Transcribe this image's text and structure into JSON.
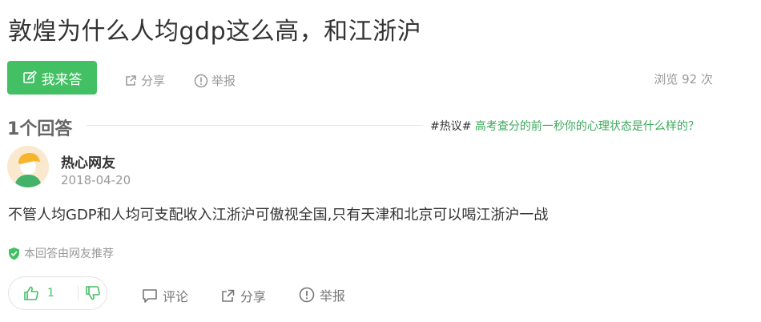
{
  "question": {
    "title": "敦煌为什么人均gdp这么高，和江浙沪",
    "answer_button_label": "我来答",
    "share_label": "分享",
    "report_label": "举报",
    "views_text": "浏览 92 次"
  },
  "answers_header": {
    "count_text": "1个回答",
    "topic_tag": "#热议#",
    "topic_question": "高考查分的前一秒你的心理状态是什么样的？"
  },
  "answer": {
    "username": "热心网友",
    "date": "2018-04-20",
    "content": "不管人均GDP和人均可支配收入江浙沪可傲视全国,只有天津和北京可以喝江浙沪一战",
    "recommend_text": "本回答由网友推荐",
    "upvotes": "1",
    "comment_label": "评论",
    "share_label": "分享",
    "report_label": "举报"
  },
  "colors": {
    "accent_green": "#43c063",
    "topic_link": "#3aa95a",
    "muted_text": "#999999"
  },
  "icons": [
    "edit-icon",
    "share-icon",
    "report-icon",
    "avatar-icon",
    "shield-check-icon",
    "thumbs-up-icon",
    "thumbs-down-icon",
    "comment-icon"
  ]
}
